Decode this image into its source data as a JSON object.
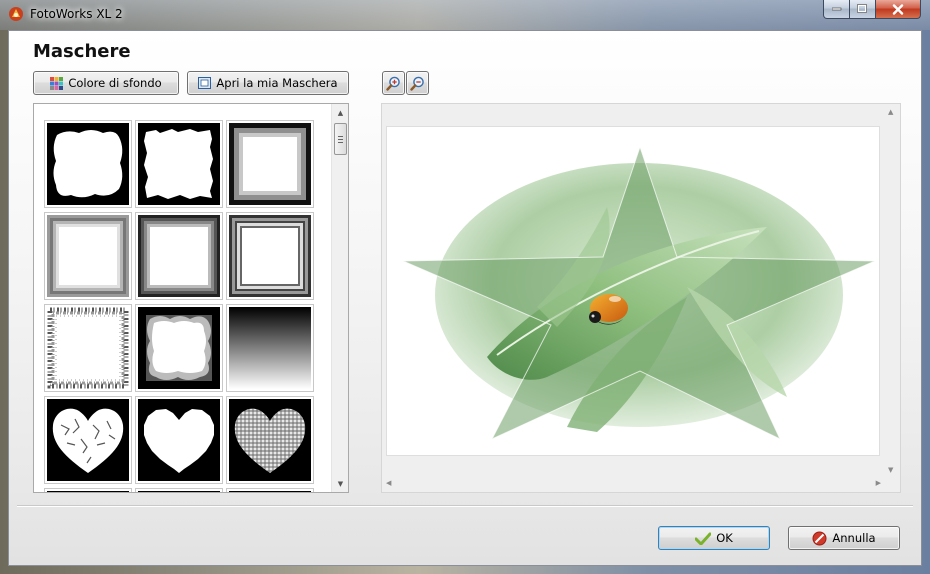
{
  "window": {
    "title": "FotoWorks XL 2",
    "controls": [
      "minimize",
      "maximize",
      "close"
    ]
  },
  "dialog": {
    "heading": "Maschere",
    "toolbar": {
      "background_color_label": "Colore di sfondo",
      "open_mask_label": "Apri la mia Maschera",
      "zoom_in_icon": "zoom-in-icon",
      "zoom_out_icon": "zoom-out-icon"
    },
    "mask_list": {
      "items": [
        "soft-torn-frame",
        "rough-torn-frame",
        "gray-bevel-frame",
        "gray-gradient-frame",
        "dark-gradient-frame",
        "double-line-frame",
        "grunge-edge-frame",
        "cloudy-edge-frame",
        "vertical-gradient",
        "cracked-heart",
        "rough-heart",
        "mosaic-heart"
      ]
    },
    "preview": {
      "mask_shape": "ellipse-star",
      "subject": "ladybug-on-leaf"
    },
    "footer": {
      "ok_label": "OK",
      "cancel_label": "Annulla"
    }
  },
  "colors": {
    "window_bg": "#f4f4f4",
    "button_border": "#707070",
    "ok_focus_border": "#3c7fb1",
    "cancel_icon": "#d03a2b",
    "ok_icon": "#7ab22a"
  }
}
